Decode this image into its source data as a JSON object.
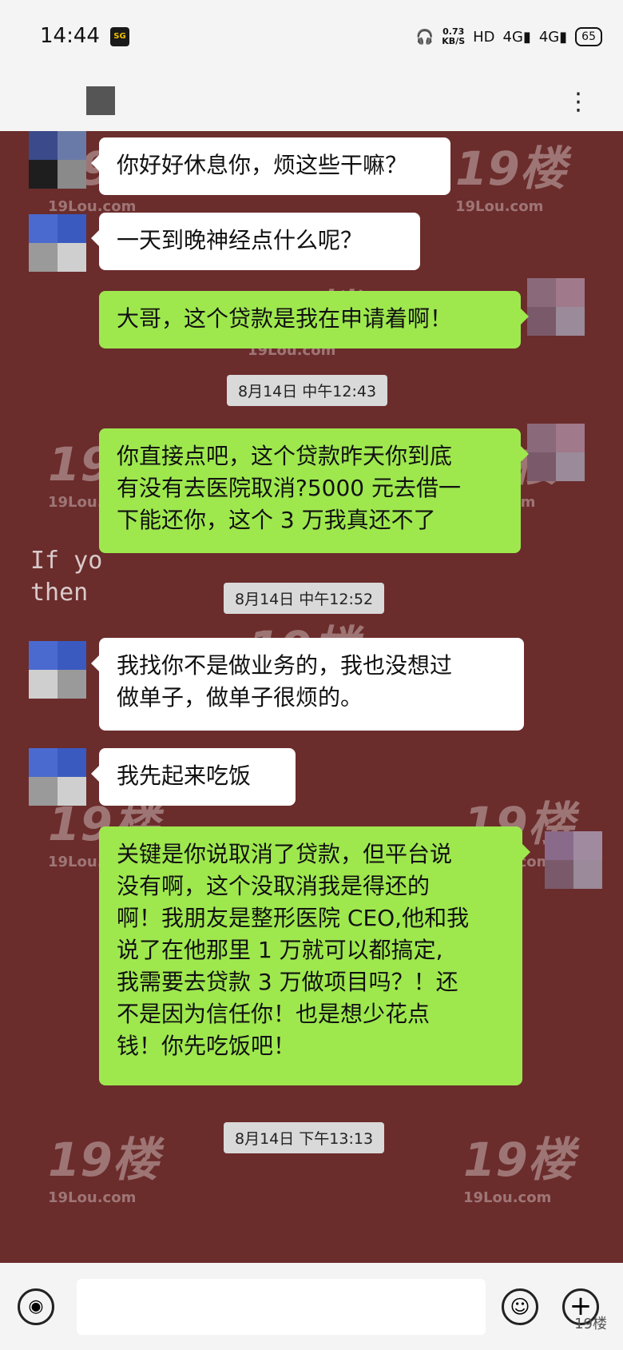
{
  "status_bar": {
    "time": "14:44",
    "app_badge": "SG",
    "net_speed_value": "0.73",
    "net_speed_unit": "KB/S",
    "hd": "HD",
    "signal1": "4G",
    "signal2": "4G",
    "battery": "65"
  },
  "header": {
    "more_icon": "ellipsis-vertical-icon"
  },
  "background_text": {
    "line1": "If yo",
    "line2": "then"
  },
  "messages": [
    {
      "side": "in",
      "text": "你好好休息你，烦这些干嘛？"
    },
    {
      "side": "in",
      "text": "一天到晚神经点什么呢？"
    },
    {
      "side": "out",
      "text": "大哥，这个贷款是我在申请着啊！"
    },
    {
      "side": "out",
      "lines": [
        "你直接点吧，这个贷款昨天你到底",
        "有没有去医院取消?5000 元去借一",
        "下能还你，这个 3 万我真还不了"
      ]
    },
    {
      "side": "in",
      "lines": [
        "我找你不是做业务的，我也没想过",
        "做单子，做单子很烦的。"
      ]
    },
    {
      "side": "in",
      "text": "我先起来吃饭"
    },
    {
      "side": "out",
      "lines": [
        "关键是你说取消了贷款，但平台说",
        "没有啊，这个没取消我是得还的",
        "啊！我朋友是整形医院 CEO,他和我",
        "说了在他那里 1 万就可以都搞定,",
        "我需要去贷款 3 万做项目吗？！还",
        "不是因为信任你！也是想少花点",
        "钱！你先吃饭吧！"
      ]
    }
  ],
  "timestamps": [
    "8月14日 中午12:43",
    "8月14日 中午12:52",
    "8月14日 下午13:13"
  ],
  "watermark": {
    "logo": "19楼",
    "site": "19Lou.com"
  },
  "bottom_bar": {
    "voice_icon": "voice-icon",
    "emoji_icon": "emoji-icon",
    "plus_icon": "plus-icon",
    "corner_mark": "19楼"
  },
  "colors": {
    "chat_bg": "#6b2c2c",
    "outgoing": "#9ee84e",
    "incoming": "#ffffff"
  }
}
